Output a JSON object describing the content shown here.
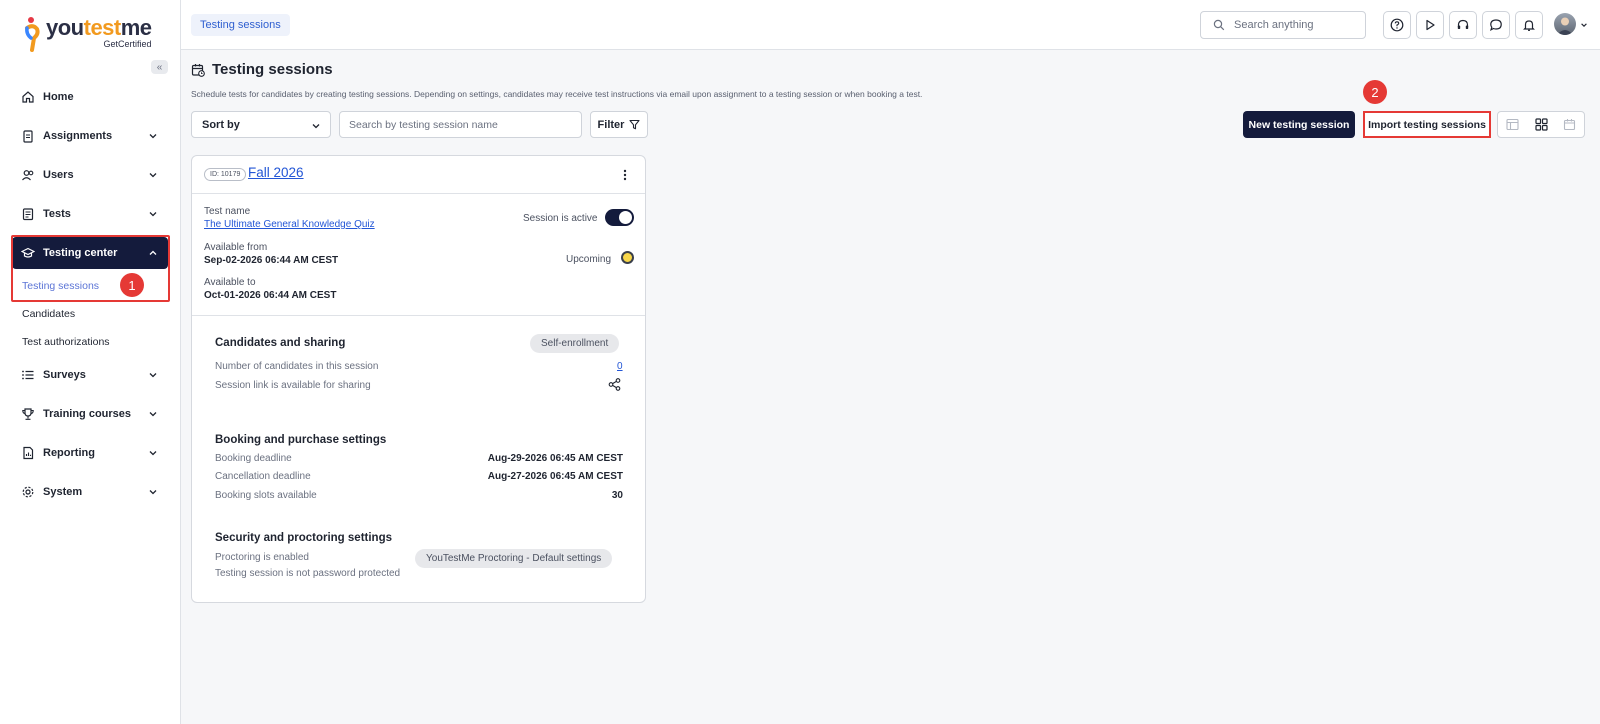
{
  "logo": {
    "part1": "you",
    "part2": "test",
    "part3": "me",
    "sub": "GetCertified"
  },
  "sidebar": {
    "collapse_icon": "«",
    "items": [
      {
        "label": "Home",
        "icon": "home-icon"
      },
      {
        "label": "Assignments",
        "icon": "clipboard-icon"
      },
      {
        "label": "Users",
        "icon": "users-icon"
      },
      {
        "label": "Tests",
        "icon": "test-icon"
      },
      {
        "label": "Testing center",
        "icon": "graduation-cap-icon"
      },
      {
        "label": "Surveys",
        "icon": "list-icon"
      },
      {
        "label": "Training courses",
        "icon": "trophy-icon"
      },
      {
        "label": "Reporting",
        "icon": "report-icon"
      },
      {
        "label": "System",
        "icon": "gear-icon"
      }
    ],
    "sub_items": [
      {
        "label": "Testing sessions"
      },
      {
        "label": "Candidates"
      },
      {
        "label": "Test authorizations"
      }
    ]
  },
  "annotations": {
    "step1": "1",
    "step2": "2"
  },
  "topbar": {
    "breadcrumb": "Testing sessions",
    "search_placeholder": "Search anything"
  },
  "page": {
    "title": "Testing sessions",
    "description": "Schedule tests for candidates by creating testing sessions. Depending on settings, candidates may receive test instructions via email upon assignment to a testing session or when booking a test."
  },
  "toolbar": {
    "sort_label": "Sort by",
    "search_placeholder": "Search by testing session name",
    "filter_label": "Filter",
    "new_label": "New testing session",
    "import_label": "Import testing sessions"
  },
  "card": {
    "id": "ID: 10179",
    "title": "Fall 2026",
    "test_name_label": "Test name",
    "test_name": "The Ultimate General Knowledge Quiz",
    "session_active_label": "Session is active",
    "session_active": true,
    "available_from_label": "Available from",
    "available_from": "Sep-02-2026 06:44 AM CEST",
    "status": "Upcoming",
    "available_to_label": "Available to",
    "available_to": "Oct-01-2026 06:44 AM CEST",
    "candidates": {
      "title": "Candidates and sharing",
      "chip": "Self-enrollment",
      "count_label": "Number of candidates in this session",
      "count": "0",
      "link_label": "Session link is available for sharing"
    },
    "booking": {
      "title": "Booking and purchase settings",
      "deadline_label": "Booking deadline",
      "deadline": "Aug-29-2026 06:45 AM CEST",
      "cancel_label": "Cancellation deadline",
      "cancel": "Aug-27-2026 06:45 AM CEST",
      "slots_label": "Booking slots available",
      "slots": "30"
    },
    "security": {
      "title": "Security and proctoring settings",
      "proctor_label": "Proctoring is enabled",
      "proctor_chip": "YouTestMe Proctoring - Default settings",
      "password_label": "Testing session is not password protected"
    }
  },
  "colors": {
    "primary": "#141b3c",
    "link": "#2356d6",
    "highlight": "#e53935",
    "accent": "#f29a1f"
  }
}
